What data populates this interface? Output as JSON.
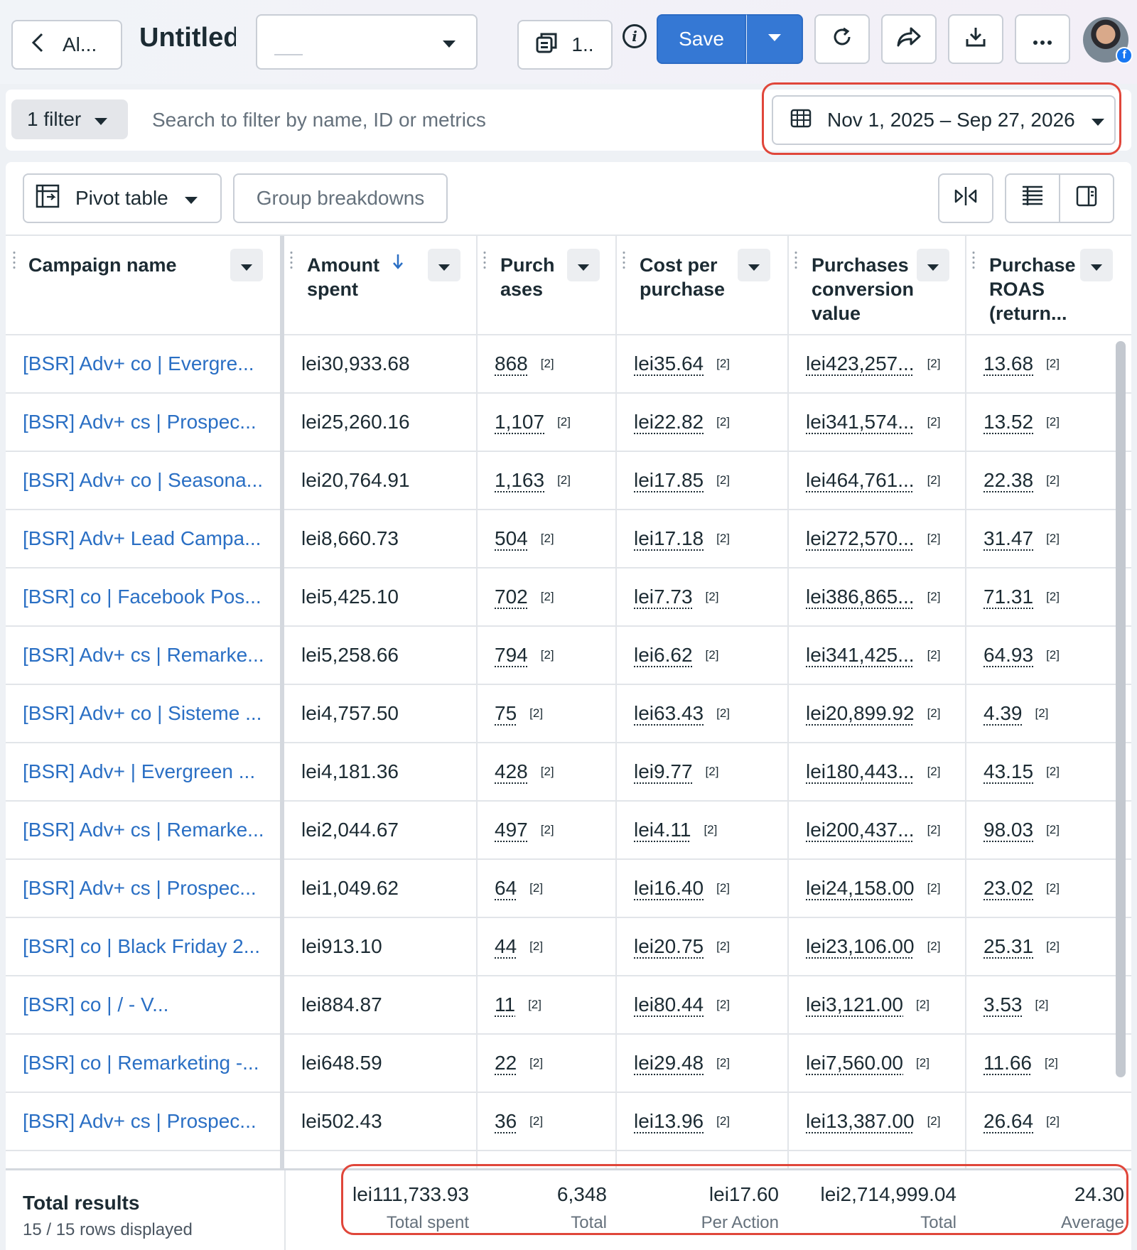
{
  "header": {
    "back_label": "Al...",
    "title": "Untitled",
    "accounts_label": "1..",
    "save_label": "Save"
  },
  "filters": {
    "chip_label": "1 filter",
    "search_placeholder": "Search to filter by name, ID or metrics",
    "date_range": "Nov 1, 2025 – Sep 27, 2026"
  },
  "toolbar": {
    "pivot_label": "Pivot table",
    "group_label": "Group breakdowns"
  },
  "columns": [
    {
      "label": "Campaign name",
      "sorted": false
    },
    {
      "label": "Amount\nspent",
      "sorted": true,
      "sort_direction": "desc"
    },
    {
      "label": "Purch\nases",
      "sorted": false
    },
    {
      "label": "Cost per\npurchase",
      "sorted": false
    },
    {
      "label": "Purchases\nconversion\nvalue",
      "sorted": false
    },
    {
      "label": "Purchase\nROAS\n(return...",
      "sorted": false
    }
  ],
  "rows": [
    {
      "name": "[BSR] Adv+ co | Evergre...",
      "spent": "lei30,933.68",
      "purchases": "868",
      "cpp": "lei35.64",
      "value": "lei423,257...",
      "roas": "13.68"
    },
    {
      "name": "[BSR] Adv+ cs | Prospec...",
      "spent": "lei25,260.16",
      "purchases": "1,107",
      "cpp": "lei22.82",
      "value": "lei341,574...",
      "roas": "13.52"
    },
    {
      "name": "[BSR] Adv+ co | Seasona...",
      "spent": "lei20,764.91",
      "purchases": "1,163",
      "cpp": "lei17.85",
      "value": "lei464,761...",
      "roas": "22.38"
    },
    {
      "name": "[BSR] Adv+ Lead Campa...",
      "spent": "lei8,660.73",
      "purchases": "504",
      "cpp": "lei17.18",
      "value": "lei272,570...",
      "roas": "31.47"
    },
    {
      "name": "[BSR] co | Facebook Pos...",
      "spent": "lei5,425.10",
      "purchases": "702",
      "cpp": "lei7.73",
      "value": "lei386,865...",
      "roas": "71.31"
    },
    {
      "name": "[BSR] Adv+ cs | Remarke...",
      "spent": "lei5,258.66",
      "purchases": "794",
      "cpp": "lei6.62",
      "value": "lei341,425...",
      "roas": "64.93"
    },
    {
      "name": "[BSR] Adv+ co | Sisteme ...",
      "spent": "lei4,757.50",
      "purchases": "75",
      "cpp": "lei63.43",
      "value": "lei20,899.92",
      "roas": "4.39"
    },
    {
      "name": "[BSR] Adv+ | Evergreen ...",
      "spent": "lei4,181.36",
      "purchases": "428",
      "cpp": "lei9.77",
      "value": "lei180,443...",
      "roas": "43.15"
    },
    {
      "name": "[BSR] Adv+ cs | Remarke...",
      "spent": "lei2,044.67",
      "purchases": "497",
      "cpp": "lei4.11",
      "value": "lei200,437...",
      "roas": "98.03"
    },
    {
      "name": "[BSR] Adv+ cs | Prospec...",
      "spent": "lei1,049.62",
      "purchases": "64",
      "cpp": "lei16.40",
      "value": "lei24,158.00",
      "roas": "23.02"
    },
    {
      "name": "[BSR] co | Black Friday 2...",
      "spent": "lei913.10",
      "purchases": "44",
      "cpp": "lei20.75",
      "value": "lei23,106.00",
      "roas": "25.31"
    },
    {
      "name": "[BSR] co | /                  - V...",
      "spent": "lei884.87",
      "purchases": "11",
      "cpp": "lei80.44",
      "value": "lei3,121.00",
      "roas": "3.53"
    },
    {
      "name": "[BSR] co | Remarketing -...",
      "spent": "lei648.59",
      "purchases": "22",
      "cpp": "lei29.48",
      "value": "lei7,560.00",
      "roas": "11.66"
    },
    {
      "name": "[BSR] Adv+ cs | Prospec...",
      "spent": "lei502.43",
      "purchases": "36",
      "cpp": "lei13.96",
      "value": "lei13,387.00",
      "roas": "26.64"
    }
  ],
  "ref_marker": "[2]",
  "totals": {
    "title": "Total results",
    "rows_displayed": "15 / 15 rows displayed",
    "spent": {
      "value": "lei111,733.93",
      "label": "Total spent"
    },
    "purchases": {
      "value": "6,348",
      "label": "Total"
    },
    "cpp": {
      "value": "lei17.60",
      "label": "Per Action"
    },
    "conv_value": {
      "value": "lei2,714,999.04",
      "label": "Total"
    },
    "roas": {
      "value": "24.30",
      "label": "Average"
    }
  },
  "colors": {
    "accent": "#3578d4",
    "link": "#2a6fc4",
    "highlight": "#e0463a"
  },
  "icons": [
    "chevron-left-icon",
    "chevron-down-icon",
    "accounts-icon",
    "info-icon",
    "refresh-icon",
    "share-icon",
    "download-icon",
    "more-icon",
    "calendar-icon",
    "pivot-icon",
    "sort-down-icon",
    "compare-icon",
    "columns-icon",
    "side-panel-icon",
    "facebook-icon"
  ]
}
